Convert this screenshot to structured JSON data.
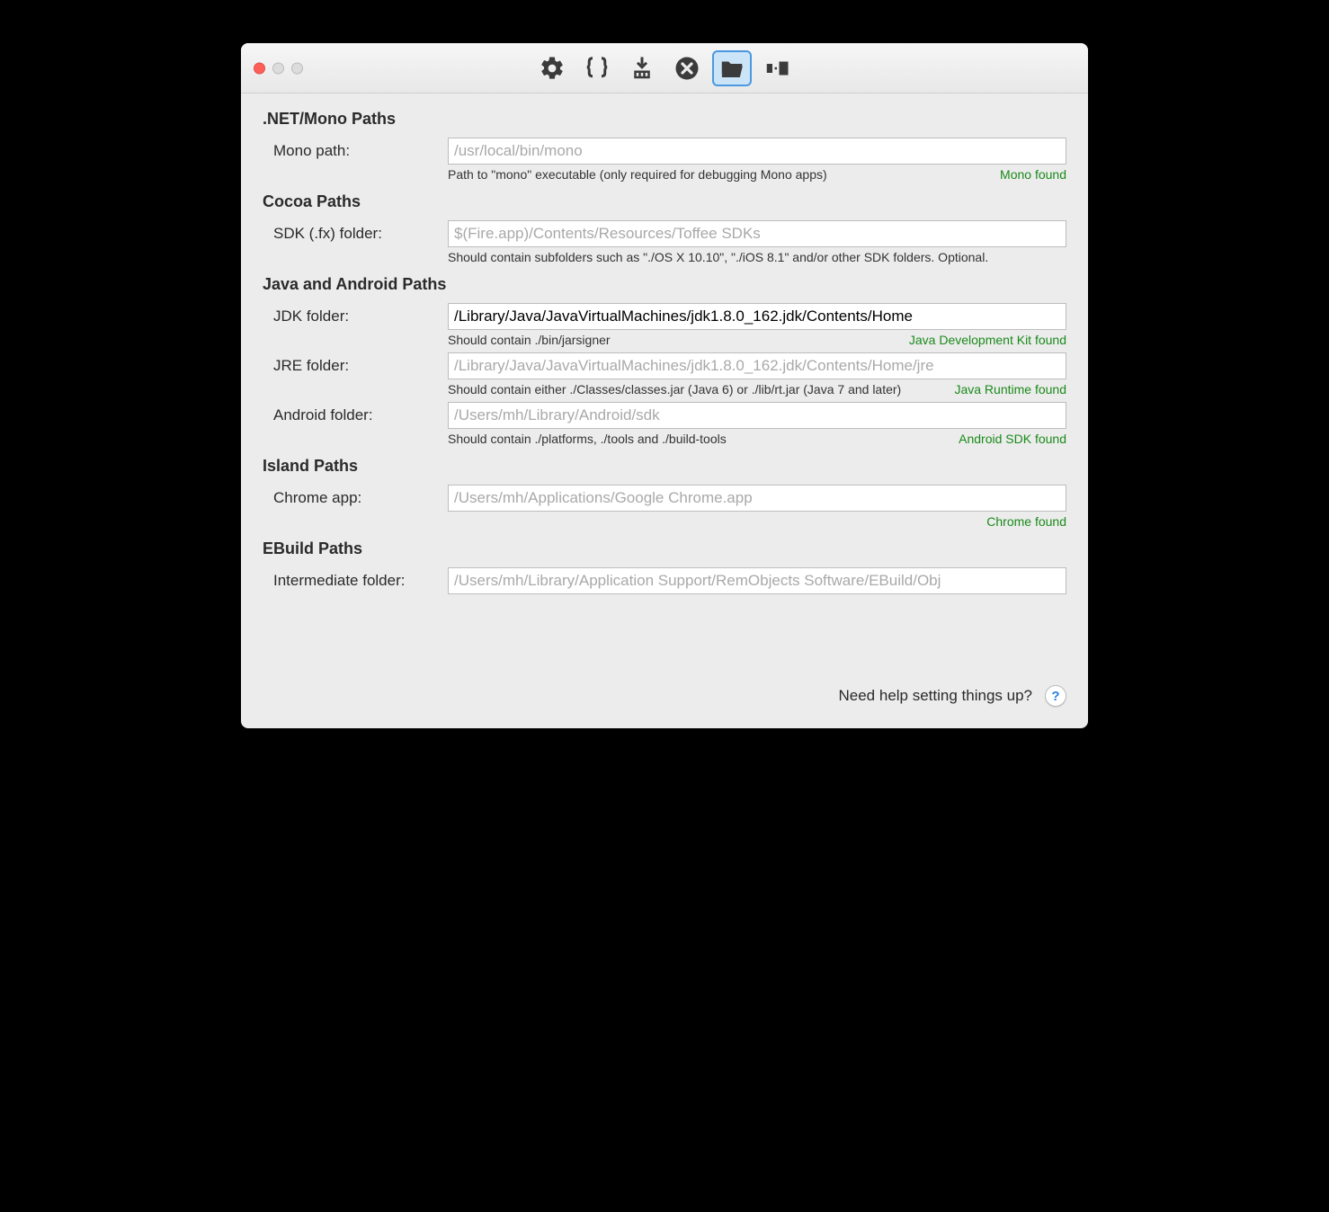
{
  "sections": {
    "net": {
      "title": ".NET/Mono Paths",
      "mono": {
        "label": "Mono path:",
        "placeholder": "/usr/local/bin/mono",
        "value": "",
        "hint": "Path to \"mono\" executable (only required for debugging Mono apps)",
        "status": "Mono found"
      }
    },
    "cocoa": {
      "title": "Cocoa Paths",
      "sdk": {
        "label": "SDK (.fx) folder:",
        "placeholder": "$(Fire.app)/Contents/Resources/Toffee SDKs",
        "value": "",
        "hint": "Should contain subfolders such as \"./OS X 10.10\", \"./iOS 8.1\" and/or other SDK folders. Optional.",
        "status": ""
      }
    },
    "java": {
      "title": "Java and Android Paths",
      "jdk": {
        "label": "JDK folder:",
        "placeholder": "",
        "value": "/Library/Java/JavaVirtualMachines/jdk1.8.0_162.jdk/Contents/Home",
        "hint": "Should contain ./bin/jarsigner",
        "status": "Java Development Kit found"
      },
      "jre": {
        "label": "JRE folder:",
        "placeholder": "/Library/Java/JavaVirtualMachines/jdk1.8.0_162.jdk/Contents/Home/jre",
        "value": "",
        "hint": "Should contain either ./Classes/classes.jar (Java 6) or ./lib/rt.jar (Java 7 and later)",
        "status": "Java Runtime found"
      },
      "android": {
        "label": "Android folder:",
        "placeholder": "/Users/mh/Library/Android/sdk",
        "value": "",
        "hint": "Should contain ./platforms, ./tools and ./build-tools",
        "status": "Android SDK found"
      }
    },
    "island": {
      "title": "Island Paths",
      "chrome": {
        "label": "Chrome app:",
        "placeholder": "/Users/mh/Applications/Google Chrome.app",
        "value": "",
        "hint": "",
        "status": "Chrome found"
      }
    },
    "ebuild": {
      "title": "EBuild Paths",
      "intermediate": {
        "label": "Intermediate folder:",
        "placeholder": "/Users/mh/Library/Application Support/RemObjects Software/EBuild/Obj",
        "value": "",
        "hint": "",
        "status": ""
      }
    }
  },
  "footer": {
    "text": "Need help setting things up?",
    "help_label": "?"
  }
}
